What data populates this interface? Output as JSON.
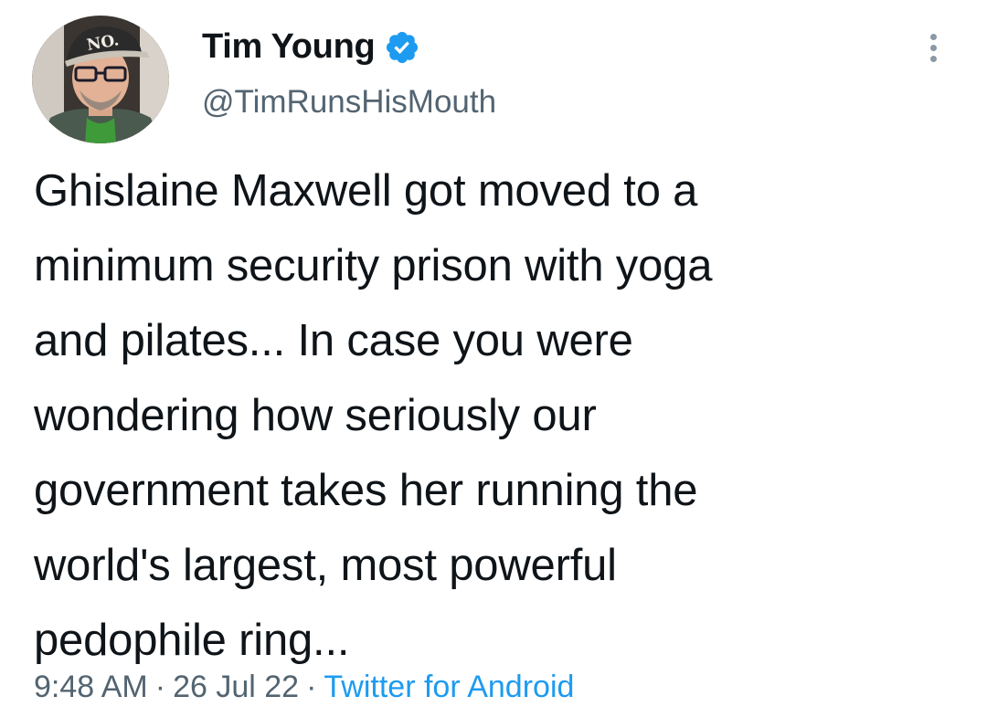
{
  "tweet": {
    "author": {
      "display_name": "Tim Young",
      "handle": "@TimRunsHisMouth",
      "verified": true,
      "verified_icon": "verified-badge-icon",
      "avatar_hat_text": "NO."
    },
    "more_icon": "more-options-icon",
    "text": "Ghislaine Maxwell got moved to a\nminimum security prison with yoga\nand pilates... In case you were\nwondering how seriously our\ngovernment takes her running the\nworld's largest, most powerful\npedophile ring...",
    "time": "9:48 AM",
    "separator": "·",
    "date": "26 Jul 22",
    "source": "Twitter for Android"
  },
  "colors": {
    "text_primary": "#0f1419",
    "text_secondary": "#536471",
    "link": "#1d9bf0",
    "verified": "#1d9bf0"
  }
}
